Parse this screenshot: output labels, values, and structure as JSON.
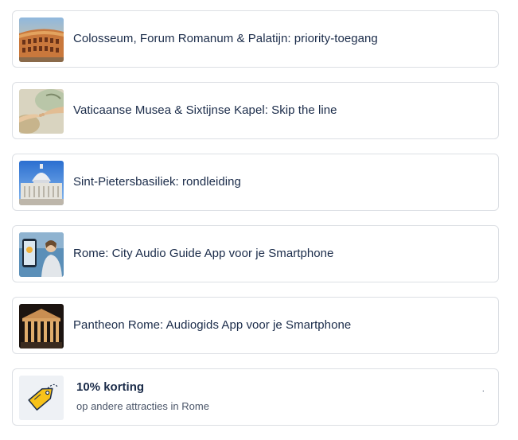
{
  "items": [
    {
      "title": "Colosseum, Forum Romanum & Palatijn: priority-toegang",
      "thumb_icon": "colosseum-photo"
    },
    {
      "title": "Vaticaanse Musea & Sixtijnse Kapel: Skip the line",
      "thumb_icon": "creation-of-adam-photo"
    },
    {
      "title": "Sint-Pietersbasiliek: rondleiding",
      "thumb_icon": "st-peters-basilica-photo"
    },
    {
      "title": "Rome: City Audio Guide App voor je Smartphone",
      "thumb_icon": "audio-guide-app-photo"
    },
    {
      "title": "Pantheon Rome: Audiogids App voor je Smartphone",
      "thumb_icon": "pantheon-photo"
    }
  ],
  "promo": {
    "title": "10% korting",
    "subtitle": "op andere attracties in Rome",
    "marker": "·",
    "icon": "price-tag-icon"
  },
  "colors": {
    "text": "#1a2b49",
    "border": "#dcdfe4",
    "tag": "#f7c21a"
  }
}
